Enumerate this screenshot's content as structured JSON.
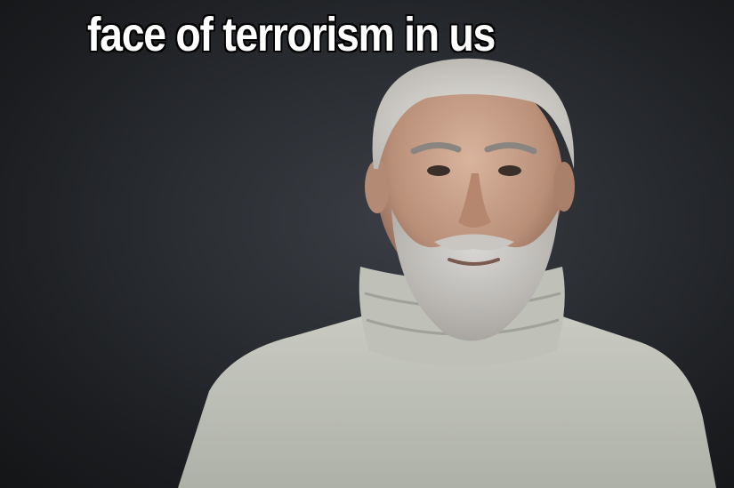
{
  "meme": {
    "caption": "face of terrorism in us"
  }
}
